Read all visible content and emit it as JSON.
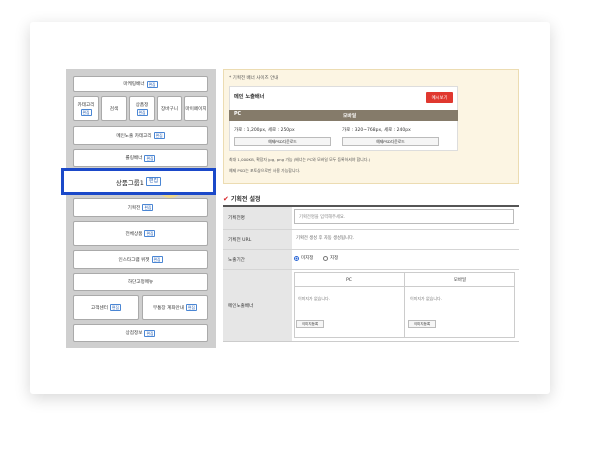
{
  "left_panel": {
    "badge_label": "편집",
    "blocks": {
      "top_banner": "마케팅배너",
      "category": "카테고리",
      "search": "검색",
      "product_info": "상품정",
      "cart": "장바구니",
      "mypage": "마이페이지",
      "main_category": "메인노출 카테고리",
      "popup_banner": "롤링배너",
      "product_group": "상품그룹1",
      "exhibition": "기획전",
      "all_products": "전체상품",
      "instagram": "인스타그램 위젯",
      "bottom_menu": "하단고정메뉴",
      "customer_center": "고객센터",
      "bank_info": "무통장 계좌안내",
      "shop_info": "상점정보"
    }
  },
  "banner_info": {
    "title": "* 기획전 배너 사이즈 안내",
    "main_banner_label": "메인 노출배너",
    "example_button": "예시보기",
    "pc_label": "PC",
    "mobile_label": "모바일",
    "pc_size": "가로 : 1,200px, 세로 : 250px",
    "mobile_size": "가로 : 320~768px, 세로 : 240px",
    "pc_download": "예제PSD다운로드",
    "mobile_download": "예제PSD다운로드",
    "note1": "최대 1,000KB, 확장자 jpg, png 가능 (배너는 PC와 모바일 모두 등록하셔야 합니다.)",
    "note2": "예제 PSD는 포토샵으로만 사용 가능합니다."
  },
  "settings": {
    "section_title": "기획전 설정",
    "name_label": "기획전명",
    "name_placeholder": "기획전명을 입력해주세요.",
    "url_label": "기획전 URL",
    "url_text": "기획전 생성 후 자동 생성됩니다.",
    "period_label": "노출기간",
    "radio_unlimited": "미지정",
    "radio_specified": "지정",
    "banner_label": "메인노출배너",
    "pc_col": "PC",
    "mobile_col": "모바일",
    "no_image": "이미지가 없습니다.",
    "register_button": "이미지등록"
  }
}
